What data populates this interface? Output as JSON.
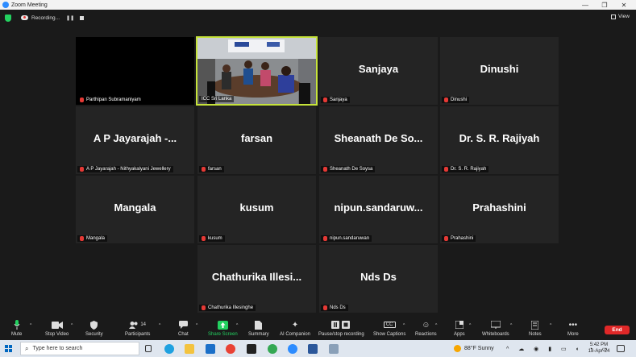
{
  "window": {
    "title": "Zoom Meeting"
  },
  "meeting": {
    "recording_label": "Recording...",
    "pause_label": "❚❚",
    "view_label": "View"
  },
  "tiles": [
    {
      "big": "",
      "tag": "Parthipan Subramaniyam"
    },
    {
      "big": "",
      "tag": "ICC Sri Lanka"
    },
    {
      "big": "Sanjaya",
      "tag": "Sanjaya"
    },
    {
      "big": "Dinushi",
      "tag": "Dinushi"
    },
    {
      "big": "A P Jayarajah -...",
      "tag": "A P Jayarajah - Nithyakalyani Jewellery"
    },
    {
      "big": "farsan",
      "tag": "farsan"
    },
    {
      "big": "Sheanath De So...",
      "tag": "Sheanath De Soysa"
    },
    {
      "big": "Dr. S. R. Rajiyah",
      "tag": "Dr. S. R. Rajiyah"
    },
    {
      "big": "Mangala",
      "tag": "Mangala"
    },
    {
      "big": "kusum",
      "tag": "kusum"
    },
    {
      "big": "nipun.sandaruw...",
      "tag": "nipun.sandaruwan"
    },
    {
      "big": "Prahashini",
      "tag": "Prahashini"
    },
    {
      "big": "Chathurika Illesi...",
      "tag": "Chathurika Illesinghe"
    },
    {
      "big": "Nds Ds",
      "tag": "Nds Ds"
    }
  ],
  "toolbar": {
    "mute": "Mute",
    "stop_video": "Stop Video",
    "security": "Security",
    "participants": "Participants",
    "participants_count": "14",
    "chat": "Chat",
    "share_screen": "Share Screen",
    "summary": "Summary",
    "ai_companion": "AI Companion",
    "pause_stop": "Pause/stop recording",
    "show_captions": "Show Captions",
    "reactions": "Reactions",
    "apps": "Apps",
    "whiteboards": "Whiteboards",
    "notes": "Notes",
    "more": "More",
    "end": "End",
    "captions_icon": "CC"
  },
  "taskbar": {
    "search_placeholder": "Type here to search",
    "weather": "88°F Sunny",
    "time": "5:42 PM",
    "date": "18-Apr-24"
  },
  "colors": {
    "accent_green": "#23d160",
    "active_border": "#c6e33b",
    "end_red": "#e02828",
    "share_green": "#23d160"
  }
}
